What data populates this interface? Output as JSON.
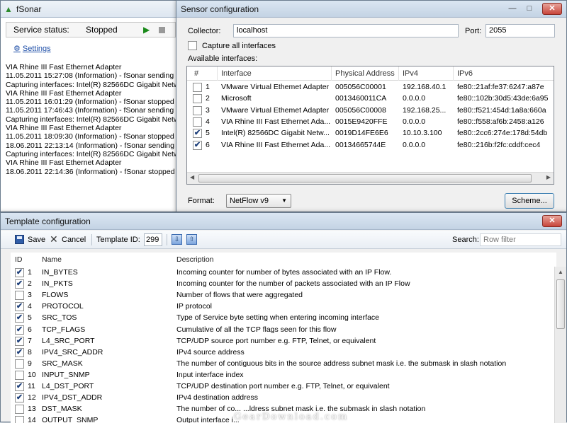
{
  "fsonar": {
    "title": "fSonar",
    "status_label": "Service status:",
    "status_value": "Stopped",
    "settings_link": "Settings",
    "log": [
      "VIA Rhine III Fast Ethernet Adapter",
      "11.05.2011 15:27:08 (Information) - fSonar sending f",
      "Capturing interfaces: Intel(R) 82566DC Gigabit Netw",
      "VIA Rhine III Fast Ethernet Adapter",
      "11.05.2011 16:01:29 (Information) - fSonar stopped c",
      "11.05.2011 17:46:43 (Information) - fSonar sending f",
      "Capturing interfaces: Intel(R) 82566DC Gigabit Netw",
      "VIA Rhine III Fast Ethernet Adapter",
      "11.05.2011 18:09:30 (Information) - fSonar stopped c",
      "18.06.2011 22:13:14 (Information) - fSonar sending f",
      "Capturing interfaces: Intel(R) 82566DC Gigabit Netw",
      "VIA Rhine III Fast Ethernet Adapter",
      "18.06.2011 22:14:36 (Information) - fSonar stopped c"
    ]
  },
  "sensor": {
    "title": "Sensor configuration",
    "collector_label": "Collector:",
    "collector_value": "localhost",
    "port_label": "Port:",
    "port_value": "2055",
    "capture_all_label": "Capture all interfaces",
    "available_label": "Available interfaces:",
    "columns": [
      "#",
      "Interface",
      "Physical Address",
      "IPv4",
      "IPv6"
    ],
    "rows": [
      {
        "checked": false,
        "num": "1",
        "iface": "VMware Virtual Ethemet Adapter",
        "mac": "005056C00001",
        "ipv4": "192.168.40.1",
        "ipv6": "fe80::21af:fe37:6247:a87e"
      },
      {
        "checked": false,
        "num": "2",
        "iface": "Microsoft",
        "mac": "0013460011CA",
        "ipv4": "0.0.0.0",
        "ipv6": "fe80::102b:30d5:43de:6a95"
      },
      {
        "checked": false,
        "num": "3",
        "iface": "VMware Virtual Ethemet Adapter",
        "mac": "005056C00008",
        "ipv4": "192.168.25...",
        "ipv6": "fe80::f521:454d:1a8a:660a"
      },
      {
        "checked": false,
        "num": "4",
        "iface": "VIA Rhine III Fast Ethernet Ada...",
        "mac": "0015E9420FFE",
        "ipv4": "0.0.0.0",
        "ipv6": "fe80::f558:af6b:2458:a126"
      },
      {
        "checked": true,
        "num": "5",
        "iface": "Intel(R) 82566DC Gigabit Netw...",
        "mac": "0019D14FE6E6",
        "ipv4": "10.10.3.100",
        "ipv6": "fe80::2cc6:274e:178d:54db"
      },
      {
        "checked": true,
        "num": "6",
        "iface": "VIA Rhine III Fast Ethernet Ada...",
        "mac": "00134665744E",
        "ipv4": "0.0.0.0",
        "ipv6": "fe80::216b:f2fc:cddf:cec4"
      }
    ],
    "format_label": "Format:",
    "format_value": "NetFlow v9",
    "scheme_button": "Scheme..."
  },
  "template": {
    "title": "Template configuration",
    "save_label": "Save",
    "cancel_label": "Cancel",
    "template_id_label": "Template ID:",
    "template_id_value": "299",
    "search_label": "Search:",
    "search_placeholder": "Row filter",
    "columns": [
      "ID",
      "Name",
      "Description"
    ],
    "rows": [
      {
        "checked": true,
        "id": "1",
        "name": "IN_BYTES",
        "desc": "Incoming counter for number of bytes associated with an IP Flow."
      },
      {
        "checked": true,
        "id": "2",
        "name": "IN_PKTS",
        "desc": "Incoming counter for the number of packets associated with an IP Flow"
      },
      {
        "checked": false,
        "id": "3",
        "name": "FLOWS",
        "desc": "Number of flows that were aggregated"
      },
      {
        "checked": true,
        "id": "4",
        "name": "PROTOCOL",
        "desc": "IP protocol"
      },
      {
        "checked": true,
        "id": "5",
        "name": "SRC_TOS",
        "desc": "Type of Service byte setting when entering incoming interface"
      },
      {
        "checked": true,
        "id": "6",
        "name": "TCP_FLAGS",
        "desc": "Cumulative of all the TCP flags seen for this flow"
      },
      {
        "checked": true,
        "id": "7",
        "name": "L4_SRC_PORT",
        "desc": "TCP/UDP source port number e.g. FTP, Telnet, or equivalent"
      },
      {
        "checked": true,
        "id": "8",
        "name": "IPV4_SRC_ADDR",
        "desc": "IPv4 source address"
      },
      {
        "checked": false,
        "id": "9",
        "name": "SRC_MASK",
        "desc": "The number of contiguous bits in the source address subnet mask i.e. the submask in slash notation"
      },
      {
        "checked": false,
        "id": "10",
        "name": "INPUT_SNMP",
        "desc": "Input interface index"
      },
      {
        "checked": true,
        "id": "11",
        "name": "L4_DST_PORT",
        "desc": "TCP/UDP destination port number e.g. FTP, Telnet, or equivalent"
      },
      {
        "checked": true,
        "id": "12",
        "name": "IPV4_DST_ADDR",
        "desc": "IPv4 destination address"
      },
      {
        "checked": false,
        "id": "13",
        "name": "DST_MASK",
        "desc": "The number of co... ...ldress subnet mask i.e. the submask in slash notation"
      },
      {
        "checked": false,
        "id": "14",
        "name": "OUTPUT_SNMP",
        "desc": "Output interface i..."
      }
    ]
  },
  "watermark": "GearDownload.com"
}
